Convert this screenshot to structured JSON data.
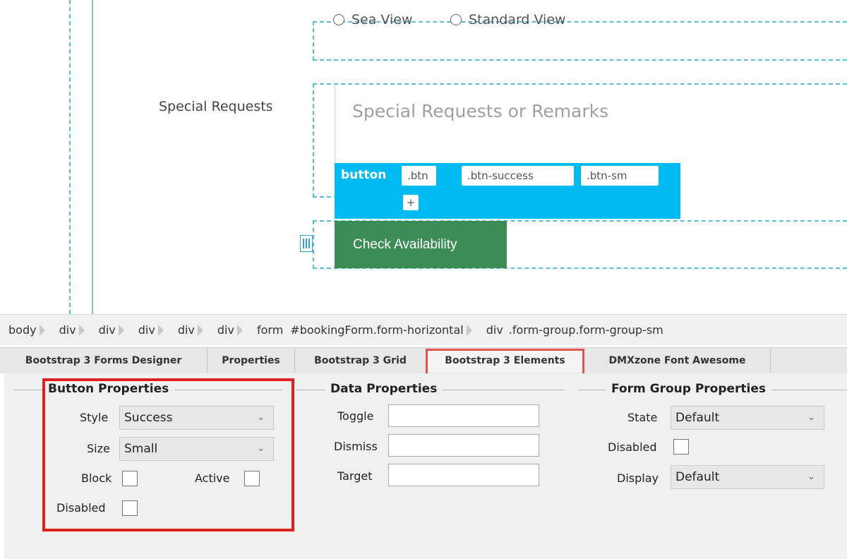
{
  "design": {
    "radio_options": [
      "Sea View",
      "Standard View"
    ],
    "special_label": "Special Requests",
    "textarea_placeholder": "Special Requests or Remarks",
    "tag_name": "button",
    "classes": [
      ".btn",
      ".btn-success",
      ".btn-sm"
    ],
    "add_class": "+",
    "check_button": "Check Availability"
  },
  "breadcrumb": [
    "body",
    "div",
    "div",
    "div",
    "div",
    "div",
    "form",
    "#bookingForm.form-horizontal",
    "div",
    ".form-group.form-group-sm"
  ],
  "tabs": [
    {
      "label": "Bootstrap 3 Forms Designer"
    },
    {
      "label": "Properties"
    },
    {
      "label": "Bootstrap 3 Grid"
    },
    {
      "label": "Bootstrap 3 Elements",
      "active": true
    },
    {
      "label": "DMXzone Font Awesome"
    }
  ],
  "button_props": {
    "title": "Button Properties",
    "style_label": "Style",
    "style_value": "Success",
    "size_label": "Size",
    "size_value": "Small",
    "block_label": "Block",
    "active_label": "Active",
    "disabled_label": "Disabled"
  },
  "data_props": {
    "title": "Data Properties",
    "toggle_label": "Toggle",
    "dismiss_label": "Dismiss",
    "target_label": "Target"
  },
  "formgroup_props": {
    "title": "Form Group Properties",
    "state_label": "State",
    "state_value": "Default",
    "disabled_label": "Disabled",
    "display_label": "Display",
    "display_value": "Default"
  },
  "colors": {
    "accent_cyan": "#00baf2",
    "success_green": "#3c8c56",
    "highlight_red": "#e01f1f"
  }
}
